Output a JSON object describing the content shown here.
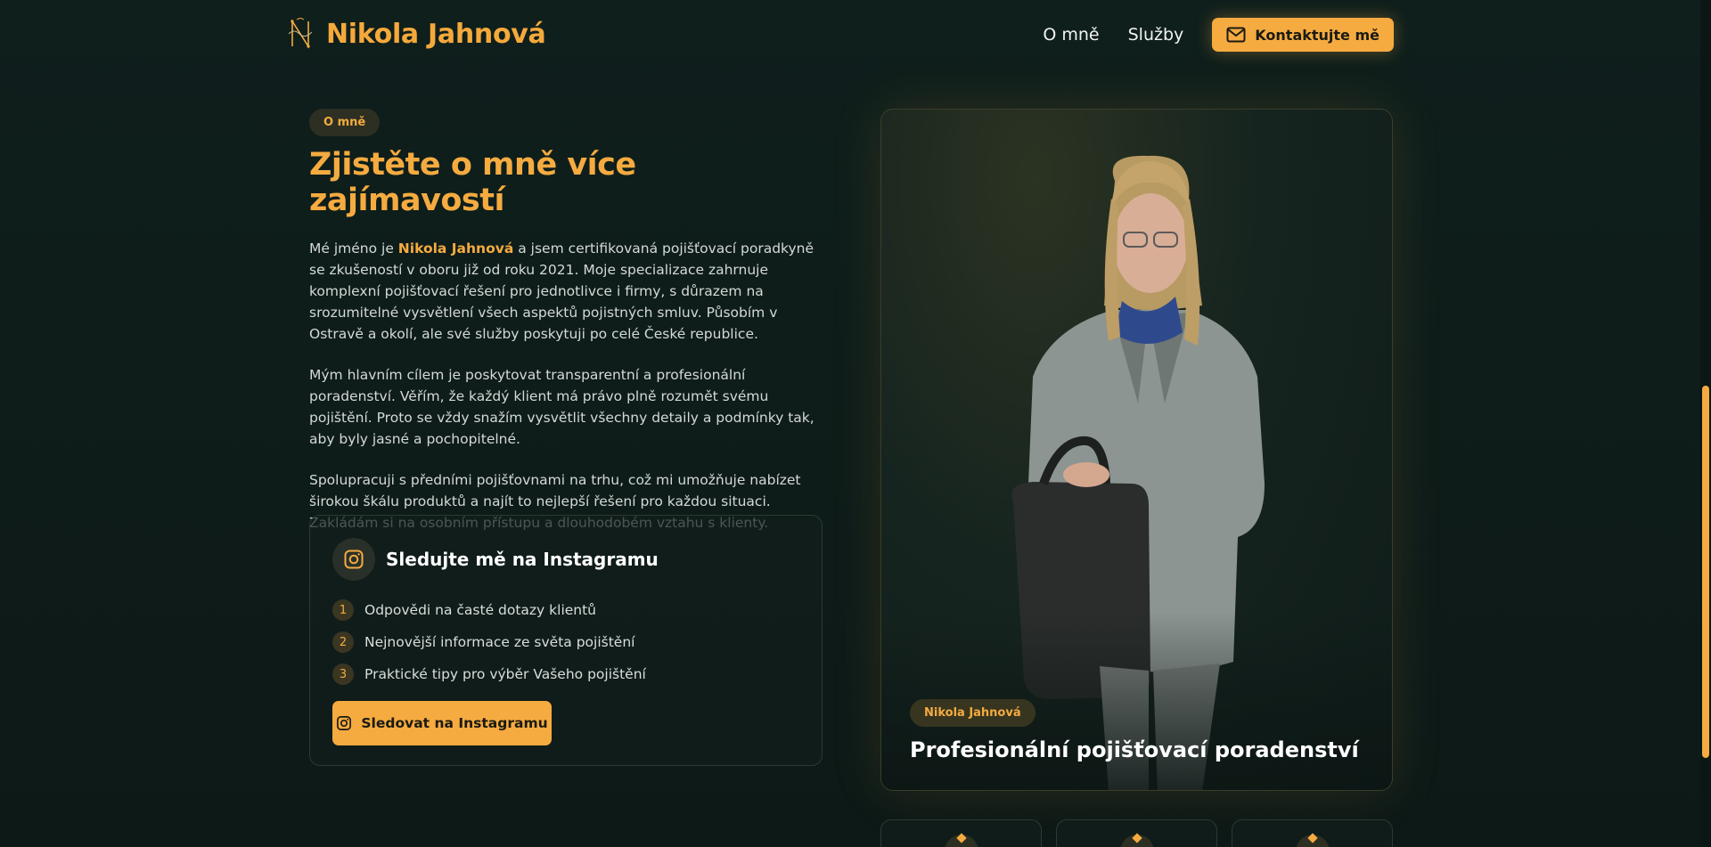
{
  "header": {
    "brand": "Nikola Jahnová",
    "nav": [
      "O mně",
      "Služby"
    ],
    "contact_label": "Kontaktujte mě",
    "logo_icon": "logo-monogram-icon",
    "mail_icon": "mail-icon"
  },
  "about": {
    "pill": "O mně",
    "title": "Zjistěte o mně více zajímavostí",
    "p1_before": "Mé jméno je ",
    "p1_name": "Nikola Jahnová",
    "p1_after": " a jsem certifikovaná pojišťovací poradkyně se zkušeností v oboru již od roku 2021. Moje specializace zahrnuje komplexní pojišťovací řešení pro jednotlivce i firmy, s důrazem na srozumitelné vysvětlení všech aspektů pojistných smluv. Působím v Ostravě a okolí, ale své služby poskytuji po celé České republice.",
    "p2": "Mým hlavním cílem je poskytovat transparentní a profesionální poradenství. Věřím, že každý klient má právo plně rozumět svému pojištění. Proto se vždy snažím vysvětlit všechny detaily a podmínky tak, aby byly jasné a pochopitelné.",
    "p3": "Spolupracuji s předními pojišťovnami na trhu, což mi umožňuje nabízet širokou škálu produktů a najít to nejlepší řešení pro každou situaci. Zakládám si na osobním přístupu a dlouhodobém vztahu s klienty."
  },
  "instagram": {
    "title": "Sledujte mě na Instagramu",
    "items": [
      {
        "num": "1",
        "text": "Odpovědi na časté dotazy klientů"
      },
      {
        "num": "2",
        "text": "Nejnovější informace ze světa pojištění"
      },
      {
        "num": "3",
        "text": "Praktické tipy pro výběr Vašeho pojištění"
      }
    ],
    "button": "Sledovat na Instagramu",
    "icon": "instagram-icon"
  },
  "photo": {
    "badge": "Nikola Jahnová",
    "caption": "Profesionální pojišťovací poradenství"
  },
  "colors": {
    "accent": "#f5ab40",
    "background": "#0f1d1b"
  }
}
